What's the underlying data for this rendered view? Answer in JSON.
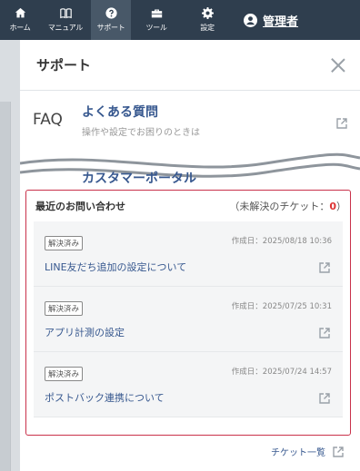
{
  "nav": {
    "items": [
      {
        "label": "ホーム",
        "icon": "home-icon"
      },
      {
        "label": "マニュアル",
        "icon": "book-icon"
      },
      {
        "label": "サポート",
        "icon": "help-icon",
        "active": true
      },
      {
        "label": "ツール",
        "icon": "toolbox-icon"
      },
      {
        "label": "設定",
        "icon": "gear-icon"
      }
    ],
    "admin_label": "管理者"
  },
  "panel": {
    "title": "サポート",
    "faq": {
      "abbr": "FAQ",
      "title": "よくある質問",
      "subtitle": "操作や設定でお困りのときは"
    },
    "portal": {
      "title": "カスタマーポータル"
    },
    "recent": {
      "title": "最近のお問い合わせ",
      "unresolved_prefix": "（未解決のチケット：",
      "unresolved_count": "0",
      "unresolved_suffix": "）",
      "tickets": [
        {
          "status": "解決済み",
          "date": "作成日：2025/08/18 10:36",
          "subject": "LINE友だち追加の設定について"
        },
        {
          "status": "解決済み",
          "date": "作成日：2025/07/25 10:31",
          "subject": "アプリ計測の設定"
        },
        {
          "status": "解決済み",
          "date": "作成日：2025/07/24 14:57",
          "subject": "ポストバック連携について"
        }
      ]
    },
    "ticket_list_link": "チケット一覧"
  },
  "colors": {
    "nav_bg": "#2f3e4e",
    "nav_active": "#485868",
    "link": "#37588f",
    "highlight_border": "#c9314a",
    "count": "#dd3333"
  }
}
